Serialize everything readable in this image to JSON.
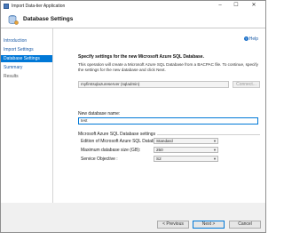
{
  "window": {
    "title": "Import Data-tier Application",
    "controls": {
      "minimize": "–",
      "maximize": "☐",
      "close": "✕"
    }
  },
  "header": {
    "title": "Database Settings",
    "icon": "database-icon"
  },
  "nav": {
    "items": [
      {
        "label": "Introduction",
        "state": "link"
      },
      {
        "label": "Import Settings",
        "state": "link"
      },
      {
        "label": "Database Settings",
        "state": "active"
      },
      {
        "label": "Summary",
        "state": "link"
      },
      {
        "label": "Results",
        "state": "dim"
      }
    ]
  },
  "main": {
    "help": "Help",
    "lead": "Specify settings for the new Microsoft Azure SQL Database.",
    "description": "This operation will create a Microsoft Azure SQL Database from a BACPAC file. To continue, specify the settings for the new database and click Next.",
    "server_value": "myfirstsqlazureserver (sqladmin)",
    "connect_label": "Connect...",
    "new_db_label": "New database name:",
    "new_db_value": "test",
    "group_title": "Microsoft Azure SQL Database settings",
    "edition_label": "Edition of Microsoft Azure SQL Database",
    "edition_value": "Standard",
    "maxsize_label": "Maximum database size (GB):",
    "maxsize_value": "250",
    "slo_label": "Service Objective :",
    "slo_value": "S2"
  },
  "footer": {
    "previous": "< Previous",
    "next": "Next >",
    "cancel": "Cancel"
  },
  "colors": {
    "accent": "#0078d7",
    "link": "#1a5aa6"
  }
}
